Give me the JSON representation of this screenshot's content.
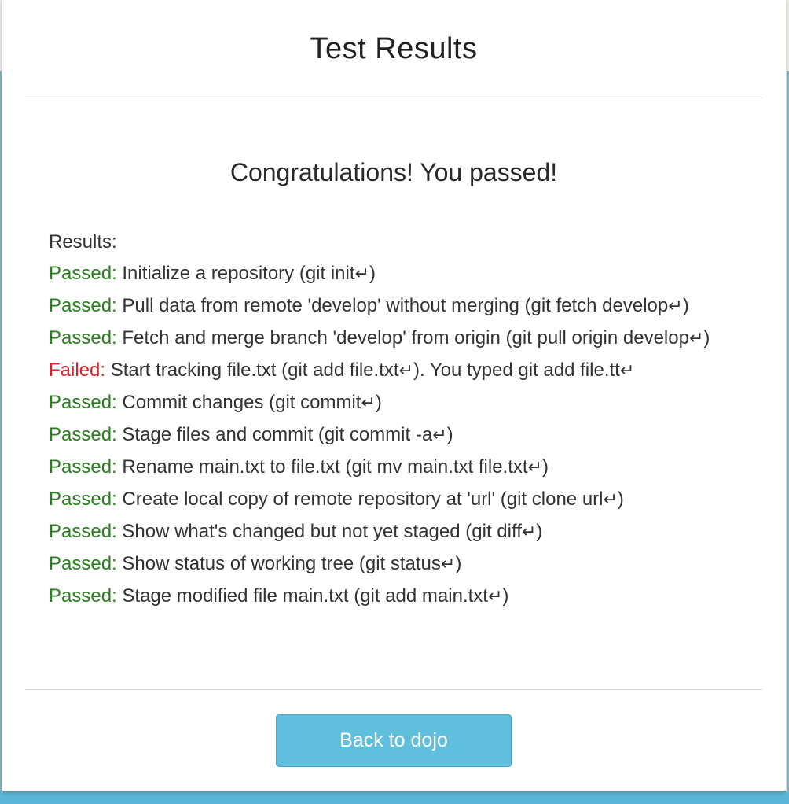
{
  "modal": {
    "title": "Test Results",
    "congrats": "Congratulations! You passed!",
    "results_heading": "Results:",
    "enter_glyph": "↵",
    "results": [
      {
        "status": "Passed:",
        "kind": "passed",
        "text": "Initialize a repository (git init",
        "after": ")"
      },
      {
        "status": "Passed:",
        "kind": "passed",
        "text": "Pull data from remote 'develop' without merging (git fetch develop",
        "after": ")"
      },
      {
        "status": "Passed:",
        "kind": "passed",
        "text": "Fetch and merge branch 'develop' from origin (git pull origin develop",
        "after": ")"
      },
      {
        "status": "Failed:",
        "kind": "failed",
        "text": "Start tracking file.txt (git add file.txt",
        "after": "). You typed git add file.tt",
        "trailing_enter": true
      },
      {
        "status": "Passed:",
        "kind": "passed",
        "text": "Commit changes (git commit",
        "after": ")"
      },
      {
        "status": "Passed:",
        "kind": "passed",
        "text": "Stage files and commit (git commit -a",
        "after": ")"
      },
      {
        "status": "Passed:",
        "kind": "passed",
        "text": "Rename main.txt to file.txt (git mv main.txt file.txt",
        "after": ")"
      },
      {
        "status": "Passed:",
        "kind": "passed",
        "text": "Create local copy of remote repository at 'url' (git clone url",
        "after": ")"
      },
      {
        "status": "Passed:",
        "kind": "passed",
        "text": "Show what's changed but not yet staged (git diff",
        "after": ")"
      },
      {
        "status": "Passed:",
        "kind": "passed",
        "text": "Show status of working tree (git status",
        "after": ")"
      },
      {
        "status": "Passed:",
        "kind": "passed",
        "text": "Stage modified file main.txt (git add main.txt",
        "after": ")"
      }
    ],
    "back_button_label": "Back to dojo"
  },
  "colors": {
    "passed": "#2a7f1f",
    "failed": "#e0202a",
    "button": "#5fbfdc"
  },
  "icons": {
    "enter": "enter-icon"
  }
}
